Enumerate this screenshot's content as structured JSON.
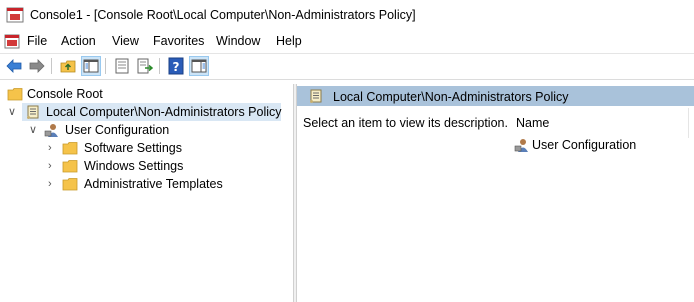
{
  "window": {
    "title": "Console1 - [Console Root\\Local Computer\\Non-Administrators Policy]"
  },
  "menu": {
    "items": [
      "File",
      "Action",
      "View",
      "Favorites",
      "Window",
      "Help"
    ]
  },
  "toolbar": {
    "buttons": [
      "back-arrow-icon",
      "forward-arrow-icon",
      "up-folder-icon",
      "show-hide-tree-icon",
      "properties-icon",
      "export-list-icon",
      "help-icon",
      "show-hide-action-pane-icon"
    ]
  },
  "tree": {
    "root": "Console Root",
    "policy": "Local Computer\\Non-Administrators Policy",
    "user_config": "User Configuration",
    "children": [
      "Software Settings",
      "Windows Settings",
      "Administrative Templates"
    ]
  },
  "result": {
    "header": "Local Computer\\Non-Administrators Policy",
    "description": "Select an item to view its description.",
    "column_name": "Name",
    "items": [
      "User Configuration"
    ]
  },
  "colors": {
    "selected": "#d9e7f4",
    "header_bar": "#a9c2da",
    "folder": "#f5c34a"
  }
}
